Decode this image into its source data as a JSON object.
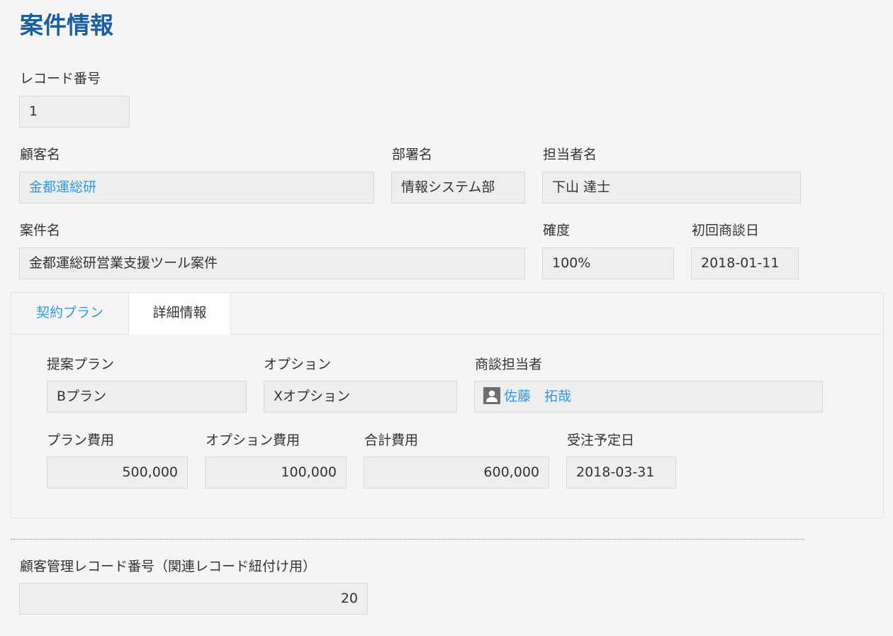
{
  "page": {
    "title": "案件情報"
  },
  "record_no": {
    "label": "レコード番号",
    "value": "1"
  },
  "customer": {
    "label": "顧客名",
    "value": "金都運総研"
  },
  "department": {
    "label": "部署名",
    "value": "情報システム部"
  },
  "person": {
    "label": "担当者名",
    "value": "下山 達士"
  },
  "deal": {
    "label": "案件名",
    "value": "金都運総研営業支援ツール案件"
  },
  "certainty": {
    "label": "確度",
    "value": "100%"
  },
  "first_meeting": {
    "label": "初回商談日",
    "value": "2018-01-11"
  },
  "tabs": [
    {
      "label": "契約プラン"
    },
    {
      "label": "詳細情報"
    }
  ],
  "plan": {
    "label": "提案プラン",
    "value": "Bプラン"
  },
  "option": {
    "label": "オプション",
    "value": "Xオプション"
  },
  "sales_rep": {
    "label": "商談担当者",
    "value": "佐藤　拓哉"
  },
  "plan_cost": {
    "label": "プラン費用",
    "value": "500,000"
  },
  "option_cost": {
    "label": "オプション費用",
    "value": "100,000"
  },
  "total_cost": {
    "label": "合計費用",
    "value": "600,000"
  },
  "order_date": {
    "label": "受注予定日",
    "value": "2018-03-31"
  },
  "customer_mgmt": {
    "label": "顧客管理レコード番号（関連レコード紐付け用）",
    "value": "20"
  },
  "colors": {
    "title": "#1b5f9e",
    "link": "#3498db",
    "field_bg": "#eeeeee",
    "page_bg": "#f5f5f5"
  }
}
